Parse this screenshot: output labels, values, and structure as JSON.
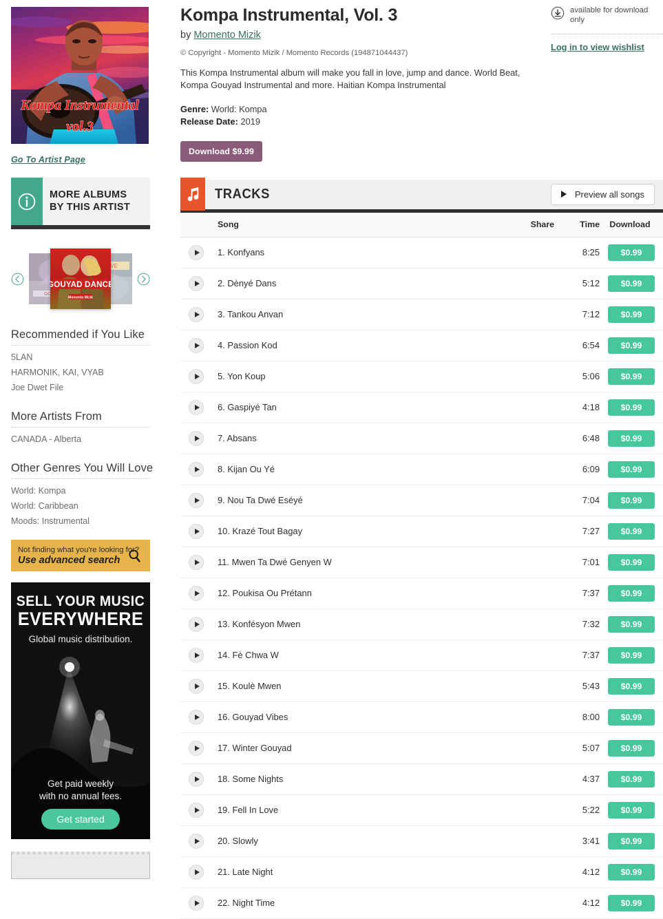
{
  "album": {
    "title": "Kompa Instrumental, Vol. 3",
    "by_prefix": "by ",
    "artist": "Momento Mizik",
    "copyright": "© Copyright - Momento Mizik / Momento Records (194871044437)",
    "description": "This Kompa Instrumental album will make you fall in love, jump and dance. World Beat, Kompa Gouyad Instrumental and more. Haitian Kompa Instrumental",
    "genre_label": "Genre:",
    "genre_value": " World: Kompa",
    "release_label": "Release Date:",
    "release_value": " 2019",
    "download_button": "Download $9.99",
    "cover_title_line1": "Kompa Instrumental",
    "cover_title_line2": "vol.3"
  },
  "top_right": {
    "availability": "available for download only",
    "availability_icon": "download-circle-icon",
    "wishlist_link": "Log in to view wishlist"
  },
  "sidebar": {
    "artist_page_link": "Go To Artist Page",
    "more_albums_label": "MORE ALBUMS BY THIS ARTIST",
    "more_albums_icon": "info-circle-icon",
    "carousel": {
      "prev_icon": "chevron-left-circle-icon",
      "next_icon": "chevron-right-circle-icon",
      "center_cover_title": "GOUYAD DANCE",
      "center_cover_subtitle": "Momento Mizik",
      "left_cover_title": "GOUYAD",
      "right_cover_title": "IN LOVE"
    },
    "sections": [
      {
        "heading": "Recommended if You Like",
        "items": [
          "5LAN",
          "HARMONIK, KAI, VYAB",
          "Joe Dwet File"
        ]
      },
      {
        "heading": "More Artists From",
        "items": [
          "CANADA - Alberta"
        ]
      },
      {
        "heading": "Other Genres You Will Love",
        "items": [
          "World: Kompa",
          "World: Caribbean",
          "Moods: Instrumental"
        ]
      }
    ],
    "advanced_search": {
      "line1": "Not finding what you're looking for?",
      "line2": "Use advanced search",
      "icon": "magnifier-icon"
    },
    "promo": {
      "title_line1": "SELL YOUR MUSIC",
      "title_line2": "EVERYWHERE",
      "subtitle": "Global music distribution.",
      "footer_line1": "Get paid weekly",
      "footer_line2": "with no annual fees.",
      "button": "Get started"
    }
  },
  "tracks_panel": {
    "icon": "music-note-icon",
    "heading": "TRACKS",
    "preview_button": "Preview all songs",
    "preview_icon": "play-triangle-icon",
    "columns": {
      "play": "",
      "song": "Song",
      "share": "Share",
      "time": "Time",
      "download": "Download"
    },
    "tracks": [
      {
        "n": "1.",
        "title": "Konfyans",
        "time": "8:25",
        "price": "$0.99"
      },
      {
        "n": "2.",
        "title": "Dènyé Dans",
        "time": "5:12",
        "price": "$0.99"
      },
      {
        "n": "3.",
        "title": "Tankou Anvan",
        "time": "7:12",
        "price": "$0.99"
      },
      {
        "n": "4.",
        "title": "Passion Kod",
        "time": "6:54",
        "price": "$0.99"
      },
      {
        "n": "5.",
        "title": "Yon Koup",
        "time": "5:06",
        "price": "$0.99"
      },
      {
        "n": "6.",
        "title": "Gaspiyé Tan",
        "time": "4:18",
        "price": "$0.99"
      },
      {
        "n": "7.",
        "title": "Absans",
        "time": "6:48",
        "price": "$0.99"
      },
      {
        "n": "8.",
        "title": "Kijan Ou Yé",
        "time": "6:09",
        "price": "$0.99"
      },
      {
        "n": "9.",
        "title": "Nou Ta Dwé Eséyé",
        "time": "7:04",
        "price": "$0.99"
      },
      {
        "n": "10.",
        "title": "Krazé Tout Bagay",
        "time": "7:27",
        "price": "$0.99"
      },
      {
        "n": "11.",
        "title": "Mwen Ta Dwé Genyen W",
        "time": "7:01",
        "price": "$0.99"
      },
      {
        "n": "12.",
        "title": "Poukisa Ou Prétann",
        "time": "7:37",
        "price": "$0.99"
      },
      {
        "n": "13.",
        "title": "Konfésyon Mwen",
        "time": "7:32",
        "price": "$0.99"
      },
      {
        "n": "14.",
        "title": "Fè Chwa W",
        "time": "7:37",
        "price": "$0.99"
      },
      {
        "n": "15.",
        "title": "Koulè Mwen",
        "time": "5:43",
        "price": "$0.99"
      },
      {
        "n": "16.",
        "title": "Gouyad Vibes",
        "time": "8:00",
        "price": "$0.99"
      },
      {
        "n": "17.",
        "title": "Winter Gouyad",
        "time": "5:07",
        "price": "$0.99"
      },
      {
        "n": "18.",
        "title": "Some Nights",
        "time": "4:37",
        "price": "$0.99"
      },
      {
        "n": "19.",
        "title": "Fell In Love",
        "time": "5:22",
        "price": "$0.99"
      },
      {
        "n": "20.",
        "title": "Slowly",
        "time": "3:41",
        "price": "$0.99"
      },
      {
        "n": "21.",
        "title": "Late Night",
        "time": "4:12",
        "price": "$0.99"
      },
      {
        "n": "22.",
        "title": "Night Time",
        "time": "4:12",
        "price": "$0.99"
      }
    ]
  },
  "colors": {
    "orange": "#e6542b",
    "green": "#46c79c",
    "teal": "#44a98b",
    "purple": "#8c5b79",
    "gold": "#e7b44b",
    "link": "#3a6f63"
  }
}
